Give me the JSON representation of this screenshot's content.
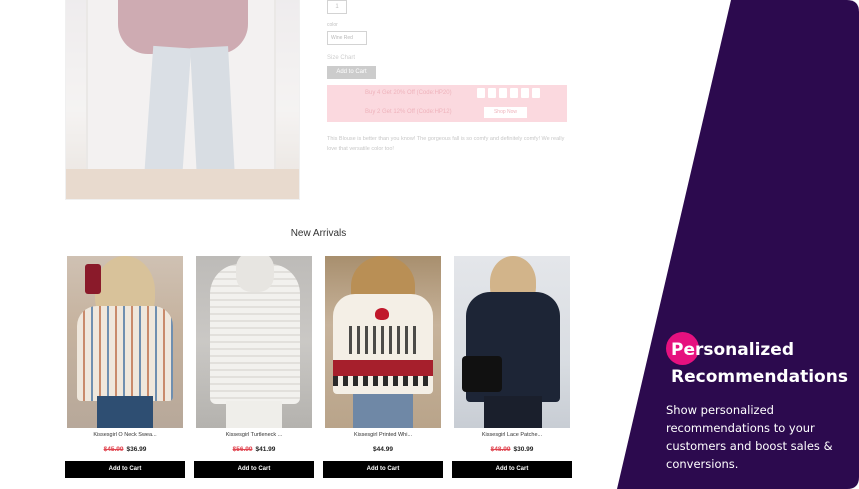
{
  "product_detail": {
    "quantity": "1",
    "color_label": "color",
    "color_value": "Wine Red",
    "size_chart_label": "Size Chart",
    "add_to_cart_label": "Add to Cart",
    "promo_line_1": "Buy 4 Get 20% Off (Code:HP20)",
    "promo_line_2": "Buy 2 Get 12% Off (Code:HP12)",
    "shop_now_label": "Shop Now",
    "description": "This Blouse is better than you know! The gorgeous fall is so comfy and definitely comfy! We really love that versatile color too!"
  },
  "new_arrivals": {
    "title": "New Arrivals",
    "products": [
      {
        "name": "Kissesgirl O Neck Swea...",
        "old_price": "$45.99",
        "price": "$36.99",
        "button": "Add to Cart"
      },
      {
        "name": "Kissesgirl Turtleneck ...",
        "old_price": "$56.99",
        "price": "$41.99",
        "button": "Add to Cart"
      },
      {
        "name": "Kissesgirl Printed Whi...",
        "old_price": "",
        "price": "$44.99",
        "button": "Add to Cart"
      },
      {
        "name": "Kissesgirl Lace Patche...",
        "old_price": "$48.99",
        "price": "$30.99",
        "button": "Add to Cart"
      }
    ]
  },
  "promo_panel": {
    "title_line_1": "Personalized",
    "title_line_2": "Recommendations",
    "description": "Show personalized recommendations to your customers and boost sales & conversions.",
    "colors": {
      "panel": "#2c0a4e",
      "accent": "#e6117f"
    }
  }
}
